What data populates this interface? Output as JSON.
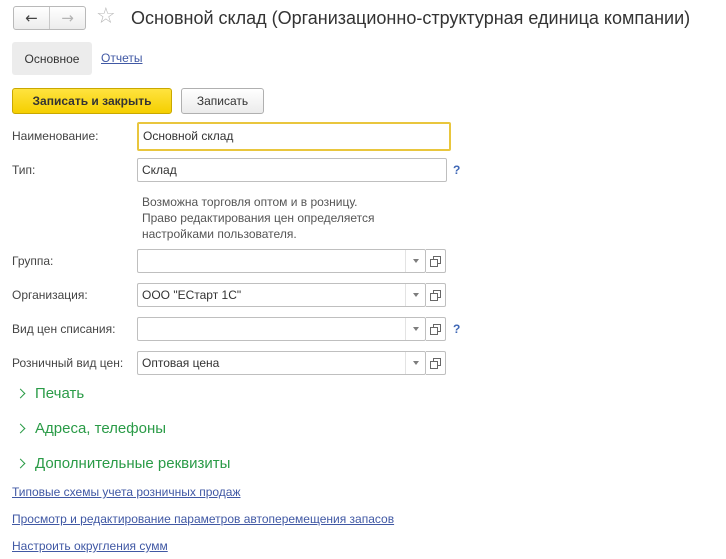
{
  "window": {
    "title": "Основной склад (Организационно-структурная единица компании)",
    "back_icon": "←",
    "forward_icon": "→",
    "favorite_icon": "☆"
  },
  "tabs": {
    "main": "Основное",
    "reports": "Отчеты"
  },
  "toolbar": {
    "save_close_label": "Записать и закрыть",
    "save_label": "Записать"
  },
  "form": {
    "name": {
      "label": "Наименование:",
      "value": "Основной склад"
    },
    "type": {
      "label": "Тип:",
      "value": "Склад",
      "help": "?",
      "info_lines": [
        "Возможна торговля оптом и в розницу.",
        "Право редактирования цен определяется",
        "настройками пользователя."
      ]
    },
    "group": {
      "label": "Группа:",
      "value": ""
    },
    "organization": {
      "label": "Организация:",
      "value": "ООО \"ЕСтарт 1С\""
    },
    "writeoff_price": {
      "label": "Вид цен списания:",
      "value": "",
      "help": "?"
    },
    "retail_price": {
      "label": "Розничный вид цен:",
      "value": "Оптовая цена"
    }
  },
  "groups": {
    "print": "Печать",
    "addresses": "Адреса, телефоны",
    "additional": "Дополнительные реквизиты"
  },
  "links": {
    "retail_schemes": "Типовые схемы учета розничных продаж",
    "auto_transfer": "Просмотр и редактирование параметров автоперемещения запасов",
    "rounding": "Настроить округления сумм"
  },
  "colors": {
    "accent_yellow": "#f5cf00",
    "link_blue": "#4058a4",
    "group_green": "#2a9b47",
    "focus_border": "#e9c63d"
  }
}
